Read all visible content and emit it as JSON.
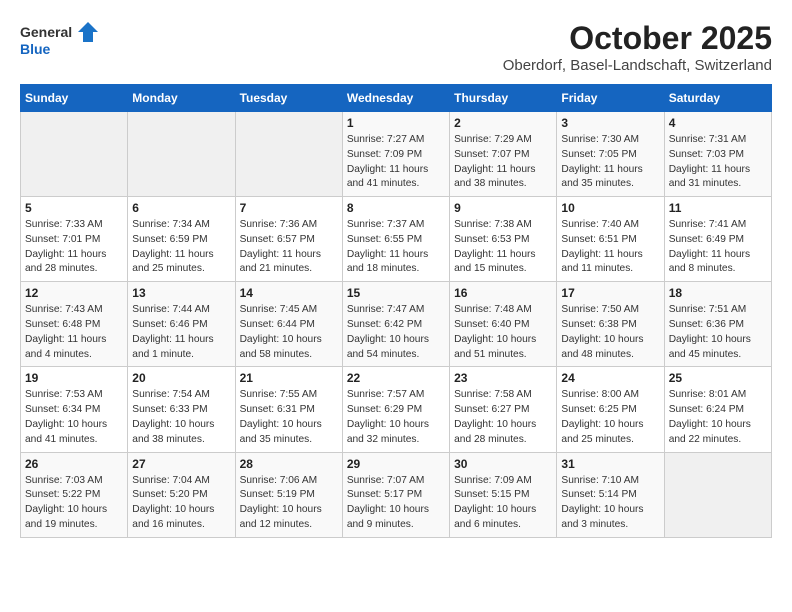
{
  "logo": {
    "text1": "General",
    "text2": "Blue"
  },
  "title": "October 2025",
  "subtitle": "Oberdorf, Basel-Landschaft, Switzerland",
  "weekdays": [
    "Sunday",
    "Monday",
    "Tuesday",
    "Wednesday",
    "Thursday",
    "Friday",
    "Saturday"
  ],
  "weeks": [
    [
      {
        "day": "",
        "info": ""
      },
      {
        "day": "",
        "info": ""
      },
      {
        "day": "",
        "info": ""
      },
      {
        "day": "1",
        "info": "Sunrise: 7:27 AM\nSunset: 7:09 PM\nDaylight: 11 hours and 41 minutes."
      },
      {
        "day": "2",
        "info": "Sunrise: 7:29 AM\nSunset: 7:07 PM\nDaylight: 11 hours and 38 minutes."
      },
      {
        "day": "3",
        "info": "Sunrise: 7:30 AM\nSunset: 7:05 PM\nDaylight: 11 hours and 35 minutes."
      },
      {
        "day": "4",
        "info": "Sunrise: 7:31 AM\nSunset: 7:03 PM\nDaylight: 11 hours and 31 minutes."
      }
    ],
    [
      {
        "day": "5",
        "info": "Sunrise: 7:33 AM\nSunset: 7:01 PM\nDaylight: 11 hours and 28 minutes."
      },
      {
        "day": "6",
        "info": "Sunrise: 7:34 AM\nSunset: 6:59 PM\nDaylight: 11 hours and 25 minutes."
      },
      {
        "day": "7",
        "info": "Sunrise: 7:36 AM\nSunset: 6:57 PM\nDaylight: 11 hours and 21 minutes."
      },
      {
        "day": "8",
        "info": "Sunrise: 7:37 AM\nSunset: 6:55 PM\nDaylight: 11 hours and 18 minutes."
      },
      {
        "day": "9",
        "info": "Sunrise: 7:38 AM\nSunset: 6:53 PM\nDaylight: 11 hours and 15 minutes."
      },
      {
        "day": "10",
        "info": "Sunrise: 7:40 AM\nSunset: 6:51 PM\nDaylight: 11 hours and 11 minutes."
      },
      {
        "day": "11",
        "info": "Sunrise: 7:41 AM\nSunset: 6:49 PM\nDaylight: 11 hours and 8 minutes."
      }
    ],
    [
      {
        "day": "12",
        "info": "Sunrise: 7:43 AM\nSunset: 6:48 PM\nDaylight: 11 hours and 4 minutes."
      },
      {
        "day": "13",
        "info": "Sunrise: 7:44 AM\nSunset: 6:46 PM\nDaylight: 11 hours and 1 minute."
      },
      {
        "day": "14",
        "info": "Sunrise: 7:45 AM\nSunset: 6:44 PM\nDaylight: 10 hours and 58 minutes."
      },
      {
        "day": "15",
        "info": "Sunrise: 7:47 AM\nSunset: 6:42 PM\nDaylight: 10 hours and 54 minutes."
      },
      {
        "day": "16",
        "info": "Sunrise: 7:48 AM\nSunset: 6:40 PM\nDaylight: 10 hours and 51 minutes."
      },
      {
        "day": "17",
        "info": "Sunrise: 7:50 AM\nSunset: 6:38 PM\nDaylight: 10 hours and 48 minutes."
      },
      {
        "day": "18",
        "info": "Sunrise: 7:51 AM\nSunset: 6:36 PM\nDaylight: 10 hours and 45 minutes."
      }
    ],
    [
      {
        "day": "19",
        "info": "Sunrise: 7:53 AM\nSunset: 6:34 PM\nDaylight: 10 hours and 41 minutes."
      },
      {
        "day": "20",
        "info": "Sunrise: 7:54 AM\nSunset: 6:33 PM\nDaylight: 10 hours and 38 minutes."
      },
      {
        "day": "21",
        "info": "Sunrise: 7:55 AM\nSunset: 6:31 PM\nDaylight: 10 hours and 35 minutes."
      },
      {
        "day": "22",
        "info": "Sunrise: 7:57 AM\nSunset: 6:29 PM\nDaylight: 10 hours and 32 minutes."
      },
      {
        "day": "23",
        "info": "Sunrise: 7:58 AM\nSunset: 6:27 PM\nDaylight: 10 hours and 28 minutes."
      },
      {
        "day": "24",
        "info": "Sunrise: 8:00 AM\nSunset: 6:25 PM\nDaylight: 10 hours and 25 minutes."
      },
      {
        "day": "25",
        "info": "Sunrise: 8:01 AM\nSunset: 6:24 PM\nDaylight: 10 hours and 22 minutes."
      }
    ],
    [
      {
        "day": "26",
        "info": "Sunrise: 7:03 AM\nSunset: 5:22 PM\nDaylight: 10 hours and 19 minutes."
      },
      {
        "day": "27",
        "info": "Sunrise: 7:04 AM\nSunset: 5:20 PM\nDaylight: 10 hours and 16 minutes."
      },
      {
        "day": "28",
        "info": "Sunrise: 7:06 AM\nSunset: 5:19 PM\nDaylight: 10 hours and 12 minutes."
      },
      {
        "day": "29",
        "info": "Sunrise: 7:07 AM\nSunset: 5:17 PM\nDaylight: 10 hours and 9 minutes."
      },
      {
        "day": "30",
        "info": "Sunrise: 7:09 AM\nSunset: 5:15 PM\nDaylight: 10 hours and 6 minutes."
      },
      {
        "day": "31",
        "info": "Sunrise: 7:10 AM\nSunset: 5:14 PM\nDaylight: 10 hours and 3 minutes."
      },
      {
        "day": "",
        "info": ""
      }
    ]
  ]
}
